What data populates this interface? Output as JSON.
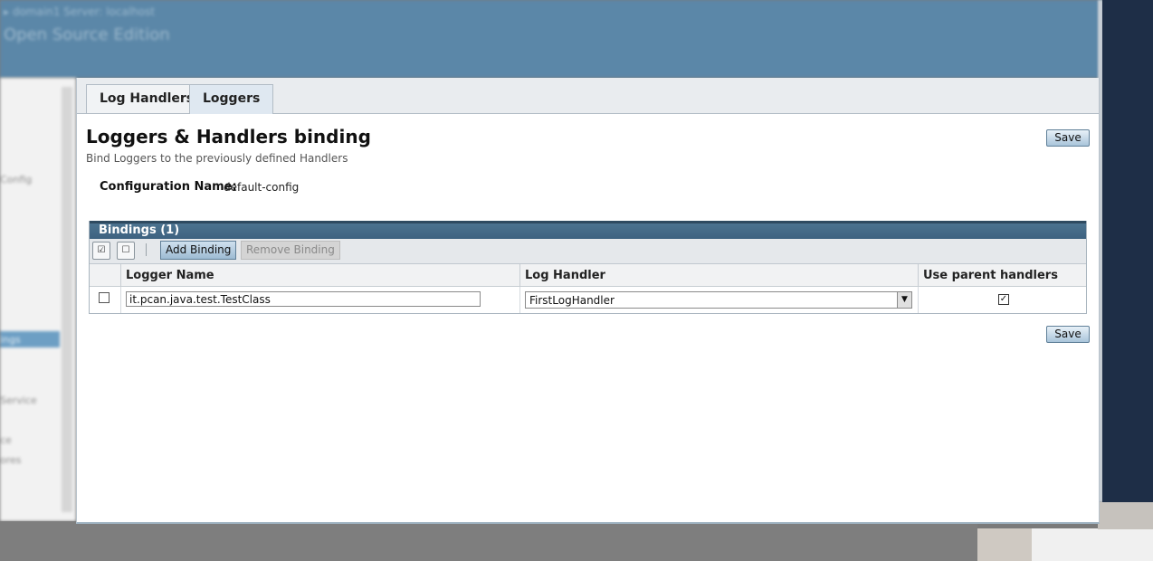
{
  "background": {
    "header_line1": "▸ domain1  Server: localhost",
    "header_line2": "Open Source Edition",
    "sidebar_items": [
      "Config",
      "ings",
      "Service",
      "ce",
      "ores"
    ]
  },
  "tabs": [
    {
      "label": "Log Handlers",
      "active": false
    },
    {
      "label": "Loggers",
      "active": true
    }
  ],
  "page": {
    "title": "Loggers & Handlers binding",
    "subtitle": "Bind Loggers to the previously defined Handlers",
    "config_label": "Configuration Name:",
    "config_value": "default-config",
    "save_label": "Save"
  },
  "bindings_table": {
    "title": "Bindings (1)",
    "toolbar": {
      "select_all_icon": "select-all-icon",
      "deselect_all_icon": "deselect-all-icon",
      "add_label": "Add Binding",
      "remove_label": "Remove Binding"
    },
    "columns": [
      "Logger Name",
      "Log Handler",
      "Use parent handlers"
    ],
    "rows": [
      {
        "selected": false,
        "logger_name": "it.pcan.java.test.TestClass",
        "log_handler": "FirstLogHandler",
        "use_parent_handlers": true
      }
    ]
  },
  "colors": {
    "header_bg": "#5b87a8",
    "table_title_bg": "#3d6280",
    "button_gradient_top": "#e8f1f8",
    "button_gradient_bottom": "#a9c4da"
  }
}
